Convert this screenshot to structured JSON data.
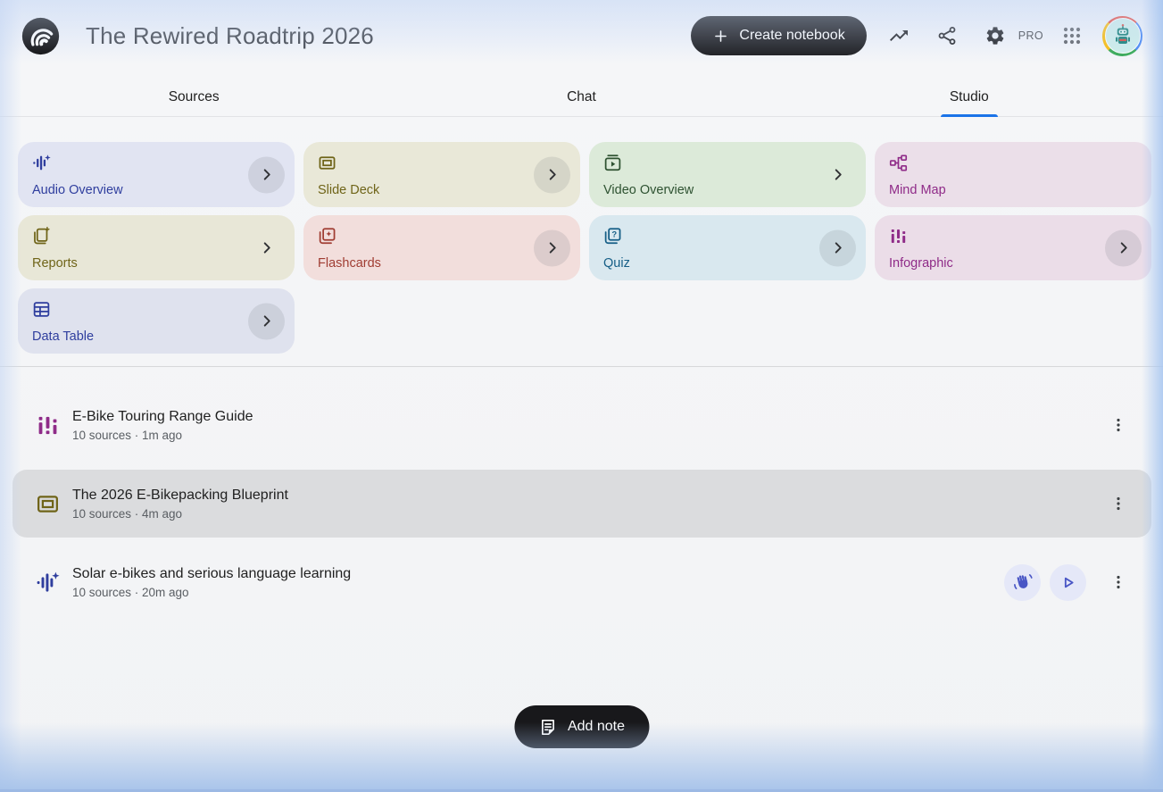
{
  "header": {
    "title": "The Rewired Roadtrip 2026",
    "create_notebook_label": "Create notebook",
    "pro_badge": "PRO"
  },
  "tabs": [
    {
      "label": "Sources",
      "active": false
    },
    {
      "label": "Chat",
      "active": false
    },
    {
      "label": "Studio",
      "active": true
    }
  ],
  "studio_cards": [
    {
      "label": "Audio Overview",
      "icon": "audio-waveform-icon",
      "bg": "#e1e4f2",
      "fg": "#2f3e9e",
      "chevron": "circle"
    },
    {
      "label": "Slide Deck",
      "icon": "slide-deck-icon",
      "bg": "#e9e8d8",
      "fg": "#6f6418",
      "chevron": "circle"
    },
    {
      "label": "Video Overview",
      "icon": "video-overview-icon",
      "bg": "#dcead9",
      "fg": "#2e5231",
      "chevron": "plain"
    },
    {
      "label": "Mind Map",
      "icon": "mind-map-icon",
      "bg": "#ebdfe9",
      "fg": "#8f2b88",
      "chevron": "none"
    },
    {
      "label": "Reports",
      "icon": "reports-icon",
      "bg": "#e8e7d7",
      "fg": "#6f6418",
      "chevron": "plain"
    },
    {
      "label": "Flashcards",
      "icon": "flashcards-icon",
      "bg": "#f2dedc",
      "fg": "#a03d33",
      "chevron": "circle"
    },
    {
      "label": "Quiz",
      "icon": "quiz-icon",
      "bg": "#d9e8ef",
      "fg": "#155e86",
      "chevron": "circle"
    },
    {
      "label": "Infographic",
      "icon": "infographic-icon",
      "bg": "#ebdde8",
      "fg": "#8f2b88",
      "chevron": "circle"
    },
    {
      "label": "Data Table",
      "icon": "data-table-icon",
      "bg": "#dfe2ee",
      "fg": "#2f3e9e",
      "chevron": "circle"
    }
  ],
  "artifacts": [
    {
      "title": "E-Bike Touring Range Guide",
      "meta": "10 sources · 1m ago",
      "icon": "infographic-icon",
      "icon_color": "#8f2b88",
      "selected": false,
      "actions": []
    },
    {
      "title": "The 2026 E-Bikepacking Blueprint",
      "meta": "10 sources · 4m ago",
      "icon": "slide-deck-icon",
      "icon_color": "#6f6418",
      "selected": true,
      "actions": []
    },
    {
      "title": "Solar e-bikes and serious language learning",
      "meta": "10 sources · 20m ago",
      "icon": "audio-waveform-icon",
      "icon_color": "#2f3e9e",
      "selected": false,
      "actions": [
        "interactive-mode",
        "play"
      ]
    }
  ],
  "add_note_label": "Add note",
  "colors": {
    "active_tab_underline": "#1a73e8",
    "selected_row_bg": "#dbdcde",
    "action_button_bg": "#e5e8f8",
    "action_icon": "#4956c5",
    "black_button_bg": "#18181b"
  }
}
